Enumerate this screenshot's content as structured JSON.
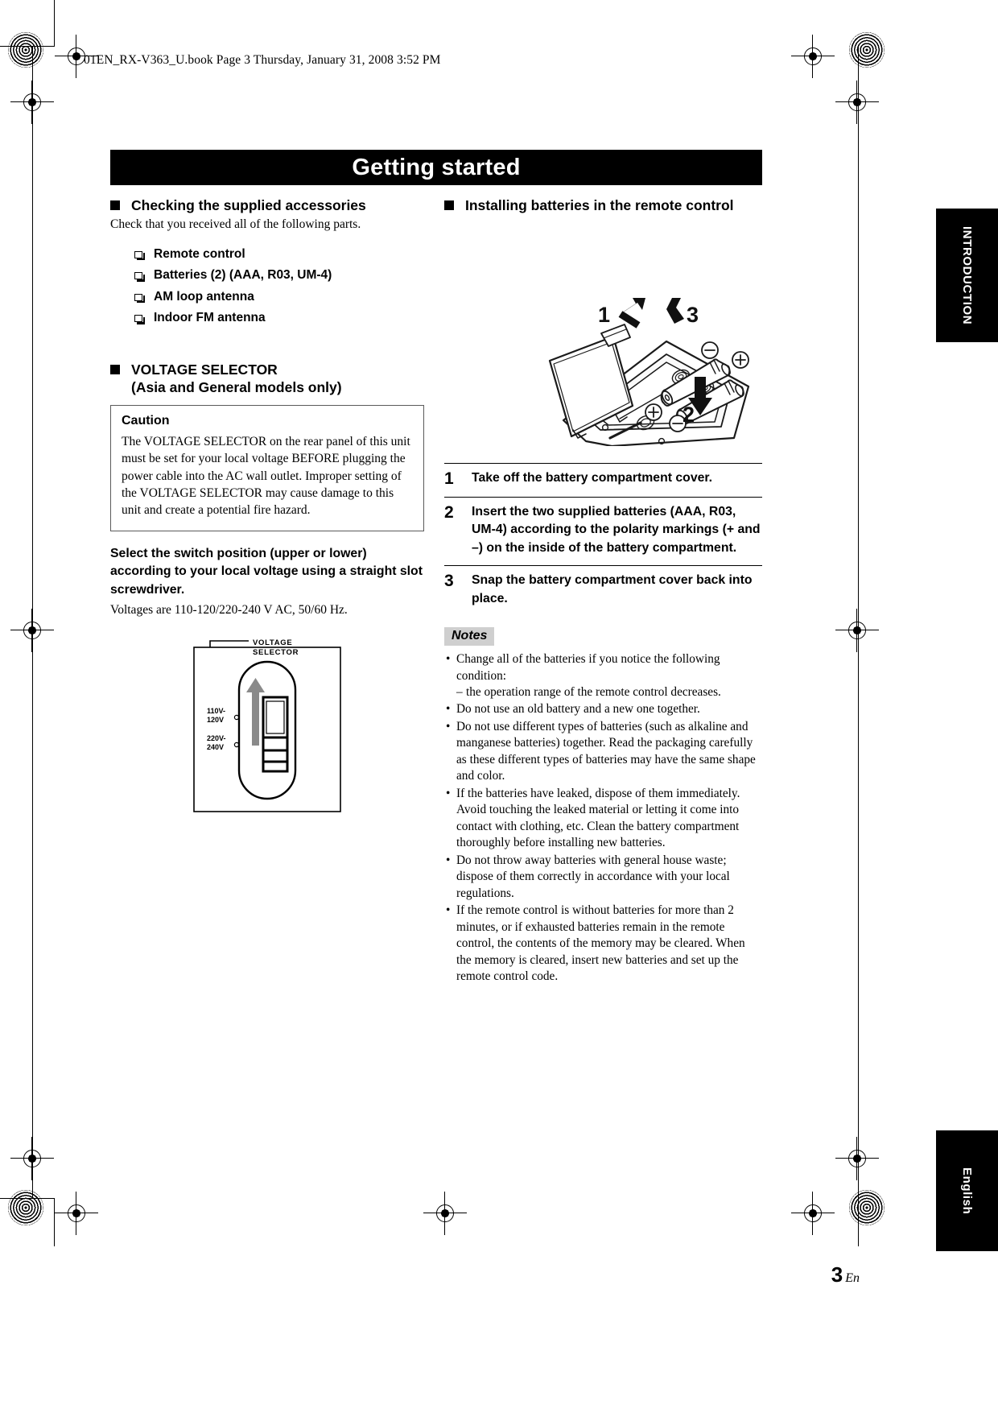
{
  "header": {
    "fileline": "01EN_RX-V363_U.book  Page 3  Thursday, January 31, 2008  3:52 PM"
  },
  "banner": {
    "title": "Getting started"
  },
  "left": {
    "accessories": {
      "heading": "Checking the supplied accessories",
      "intro": "Check that you received all of the following parts.",
      "items": [
        "Remote control",
        "Batteries (2) (AAA, R03, UM-4)",
        "AM loop antenna",
        "Indoor FM antenna"
      ]
    },
    "voltage": {
      "heading_line1": "VOLTAGE SELECTOR",
      "heading_line2": "(Asia and General models only)",
      "caution_title": "Caution",
      "caution_body": "The VOLTAGE SELECTOR on the rear panel of this unit must be set for your local voltage BEFORE plugging the power cable into the AC wall outlet. Improper setting of the VOLTAGE SELECTOR may cause damage to this unit and create a potential fire hazard.",
      "instruction": "Select the switch position (upper or lower) according to your local voltage using a straight slot screwdriver.",
      "voltages": "Voltages are 110-120/220-240 V AC, 50/60 Hz.",
      "figure": {
        "label_line1": "VOLTAGE",
        "label_line2": "SELECTOR",
        "upper_line1": "110V-",
        "upper_line2": "120V",
        "lower_line1": "220V-",
        "lower_line2": "240V"
      }
    }
  },
  "right": {
    "batteries": {
      "heading": "Installing batteries in the remote control",
      "figure_callouts": [
        "1",
        "3",
        "2"
      ],
      "polarity": {
        "minus": "−",
        "plus": "+"
      },
      "steps": [
        {
          "num": "1",
          "text": "Take off the battery compartment cover."
        },
        {
          "num": "2",
          "text": "Insert the two supplied batteries (AAA, R03, UM-4) according to the polarity markings (+ and –) on the inside of the battery compartment."
        },
        {
          "num": "3",
          "text": "Snap the battery compartment cover back into place."
        }
      ],
      "notes_label": "Notes",
      "notes": [
        {
          "text": "Change all of the batteries if you notice the following condition:",
          "sub": "the operation range of the remote control decreases."
        },
        {
          "text": "Do not use an old battery and a new one together."
        },
        {
          "text": "Do not use different types of batteries (such as alkaline and manganese batteries) together. Read the packaging carefully as these different types of batteries may have the same shape and color."
        },
        {
          "text": "If the batteries have leaked, dispose of them immediately. Avoid touching the leaked material or letting it come into contact with clothing, etc. Clean the battery compartment thoroughly before installing new batteries."
        },
        {
          "text": "Do not throw away batteries with general house waste; dispose of them correctly in accordance with your local regulations."
        },
        {
          "text": "If the remote control is without batteries for more than 2 minutes, or if exhausted batteries remain in the remote control, the contents of the memory may be cleared. When the memory is cleared, insert new batteries and set up the remote control code."
        }
      ]
    }
  },
  "tabs": {
    "introduction": "INTRODUCTION",
    "english": "English"
  },
  "footer": {
    "page_number": "3",
    "page_suffix": "En"
  },
  "colors": {
    "banner_bg": "#000000",
    "notes_tag_bg": "#cfcfcf",
    "caution_border": "#5a5a5a",
    "figure_gray": "#808080"
  }
}
